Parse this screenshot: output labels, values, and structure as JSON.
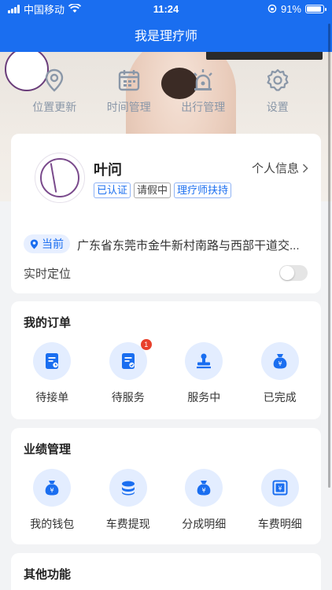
{
  "status_bar": {
    "carrier": "中国移动",
    "time": "11:24",
    "battery": "91%",
    "battery_level": 0.91
  },
  "nav": {
    "title": "我是理疗师"
  },
  "quick_actions": [
    {
      "label": "位置更新",
      "icon": "location-pin-icon"
    },
    {
      "label": "时间管理",
      "icon": "calendar-icon"
    },
    {
      "label": "出行管理",
      "icon": "alarm-light-icon"
    },
    {
      "label": "设置",
      "icon": "gear-icon"
    }
  ],
  "profile": {
    "name": "叶问",
    "link_label": "个人信息",
    "tags": [
      "已认证",
      "请假中",
      "理疗师扶持"
    ],
    "location_label": "当前",
    "location_text": "广东省东莞市金牛新村南路与西部干道交...",
    "realtime_label": "实时定位",
    "realtime_on": false
  },
  "orders": {
    "title": "我的订单",
    "items": [
      {
        "label": "待接单",
        "icon": "document-icon",
        "badge": ""
      },
      {
        "label": "待服务",
        "icon": "document-check-icon",
        "badge": "1"
      },
      {
        "label": "服务中",
        "icon": "stamp-icon",
        "badge": ""
      },
      {
        "label": "已完成",
        "icon": "money-bag-icon",
        "badge": ""
      }
    ]
  },
  "performance": {
    "title": "业绩管理",
    "items": [
      {
        "label": "我的钱包",
        "icon": "wallet-bag-icon"
      },
      {
        "label": "车费提现",
        "icon": "coins-icon"
      },
      {
        "label": "分成明细",
        "icon": "money-bag-icon"
      },
      {
        "label": "车费明细",
        "icon": "yen-receipt-icon"
      }
    ]
  },
  "other": {
    "title": "其他功能"
  },
  "colors": {
    "primary": "#1a6ef0",
    "icon_bg": "#e3edff",
    "badge": "#e8412c"
  }
}
